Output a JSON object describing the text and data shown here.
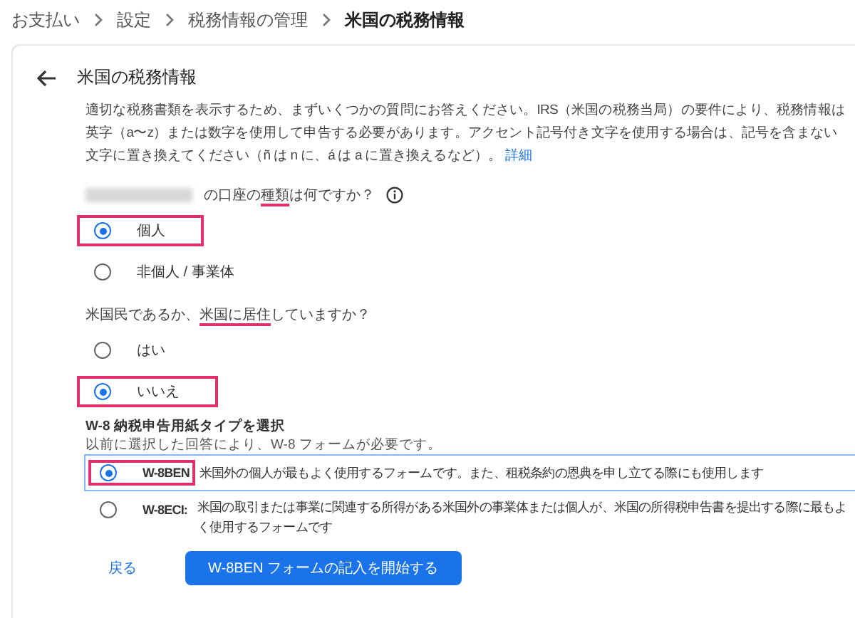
{
  "breadcrumb": [
    {
      "label": "お支払い",
      "current": false
    },
    {
      "label": "設定",
      "current": false
    },
    {
      "label": "税務情報の管理",
      "current": false
    },
    {
      "label": "米国の税務情報",
      "current": true
    }
  ],
  "card": {
    "title": "米国の税務情報",
    "description": "適切な税務書類を表示するため、まずいくつかの質問にお答えください。IRS（米国の税務当局）の要件により、税務情報は英字（a〜z）または数字を使用して申告する必要があります。アクセント記号付き文字を使用する場合は、記号を含まない文字に置き換えてください（ñ は n に、á は a に置き換えるなど）。",
    "details_link": "詳細",
    "questions": [
      {
        "parts": [
          {
            "text": "の口座の",
            "underlined": false
          },
          {
            "text": "種類",
            "underlined": true
          },
          {
            "text": "は何ですか？",
            "underlined": false
          }
        ],
        "redacted_prefix": true,
        "info": true,
        "options": [
          {
            "label": "個人",
            "selected": true,
            "highlighted": true
          },
          {
            "label": "非個人 / 事業体",
            "selected": false,
            "highlighted": false
          }
        ]
      },
      {
        "parts": [
          {
            "text": "米国民であるか、",
            "underlined": false
          },
          {
            "text": "米国に居住",
            "underlined": true
          },
          {
            "text": "していますか？",
            "underlined": false
          }
        ],
        "redacted_prefix": false,
        "info": false,
        "options": [
          {
            "label": "はい",
            "selected": false,
            "highlighted": false
          },
          {
            "label": "いいえ",
            "selected": true,
            "highlighted": true
          }
        ]
      }
    ],
    "form_section": {
      "heading": "W-8 納税申告用紙タイプを選択",
      "subtitle": "以前に選択した回答により、W-8 フォームが必要です。",
      "options": [
        {
          "code": "W-8BEN",
          "text": "米国外の個人が最もよく使用するフォームです。また、租税条約の恩典を申し立てる際にも使用します",
          "selected": true,
          "highlighted": true
        },
        {
          "code": "W-8ECI:",
          "text": "米国の取引または事業に関連する所得がある米国外の事業体または個人が、米国の所得税申告書を提出する際に最もよく使用するフォームです",
          "selected": false,
          "highlighted": false
        }
      ]
    },
    "back_button": "戻る",
    "start_button": "W-8BEN フォームの記入を開始する"
  }
}
